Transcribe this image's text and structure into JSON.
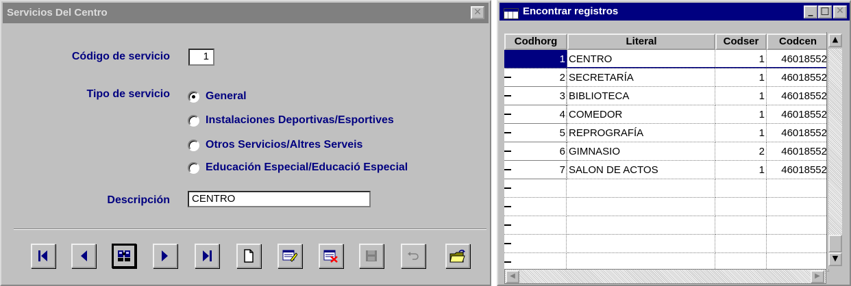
{
  "form": {
    "title": "Servicios Del Centro",
    "close_icon": "close-icon",
    "code_label": "Código de servicio",
    "code_value": "1",
    "type_label": "Tipo de servicio",
    "service_types": [
      {
        "label": "General",
        "checked": true
      },
      {
        "label": "Instalaciones Deportivas/Esportives",
        "checked": false
      },
      {
        "label": "Otros Servicios/Altres Serveis",
        "checked": false
      },
      {
        "label": "Educación Especial/Educació Especial",
        "checked": false
      }
    ],
    "description_label": "Descripción",
    "description_value": "CENTRO",
    "toolbar_icons": [
      "first-record-icon",
      "previous-record-icon",
      "find-icon",
      "next-record-icon",
      "last-record-icon",
      "new-record-icon",
      "edit-record-icon",
      "delete-record-icon",
      "save-icon",
      "undo-icon",
      "exit-icon"
    ]
  },
  "finder": {
    "title": "Encontrar registros",
    "window_icons": [
      "minimize-icon",
      "maximize-icon",
      "close-icon"
    ],
    "columns": [
      "Codhorg",
      "Literal",
      "Codser",
      "Codcen"
    ],
    "rows": [
      [
        "1",
        "CENTRO",
        "1",
        "46018552"
      ],
      [
        "2",
        "SECRETARÍA",
        "1",
        "46018552"
      ],
      [
        "3",
        "BIBLIOTECA",
        "1",
        "46018552"
      ],
      [
        "4",
        "COMEDOR",
        "1",
        "46018552"
      ],
      [
        "5",
        "REPROGRAFÍA",
        "1",
        "46018552"
      ],
      [
        "6",
        "GIMNASIO",
        "2",
        "46018552"
      ],
      [
        "7",
        "SALON DE ACTOS",
        "1",
        "46018552"
      ]
    ],
    "selected_row": 1,
    "empty_rows": 5
  }
}
